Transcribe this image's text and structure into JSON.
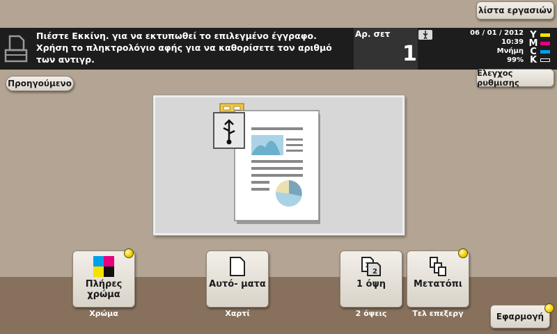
{
  "header": {
    "job_list_label": "λίστα εργασιών",
    "message": "Πιέστε Εκκίνη.  για να εκτυπωθεί το επιλεγμένο έγγραφο. Χρήση το πληκτρολόγιο αφής για να καθορίσετε τον αριθμό των αντιγρ.",
    "copies_label": "Αρ. σετ",
    "copies_value": "1",
    "date": "06 / 01 / 2012",
    "time": "10:39",
    "memory_label": "Μνήμη",
    "memory_value": "99%",
    "check_settings_label": "Ελεγχος ρυθμισης"
  },
  "toner": [
    {
      "letter": "Y",
      "color": "#f5e100"
    },
    {
      "letter": "M",
      "color": "#e6007e"
    },
    {
      "letter": "C",
      "color": "#00a0e9"
    },
    {
      "letter": "K",
      "color": "#111111"
    }
  ],
  "nav": {
    "previous_label": "Προηγούμενο"
  },
  "functions": [
    {
      "label": "Πλήρες χρώμα",
      "sub": "Χρώμα",
      "icon": "color-squares-icon"
    },
    {
      "label": "Αυτό- ματα",
      "sub": "Χαρτί",
      "icon": "paper-icon"
    },
    {
      "label": "1 όψη",
      "sub": "2 όψεις",
      "icon": "duplex-icon"
    },
    {
      "label": "Μετατόπι",
      "sub": "Τελ επεξεργ",
      "icon": "offset-icon"
    }
  ],
  "apply_label": "Εφαρμογή",
  "colors": {
    "accent_dot": "#f2d000",
    "background": "#b3a493",
    "bottom_band": "#87715d"
  }
}
